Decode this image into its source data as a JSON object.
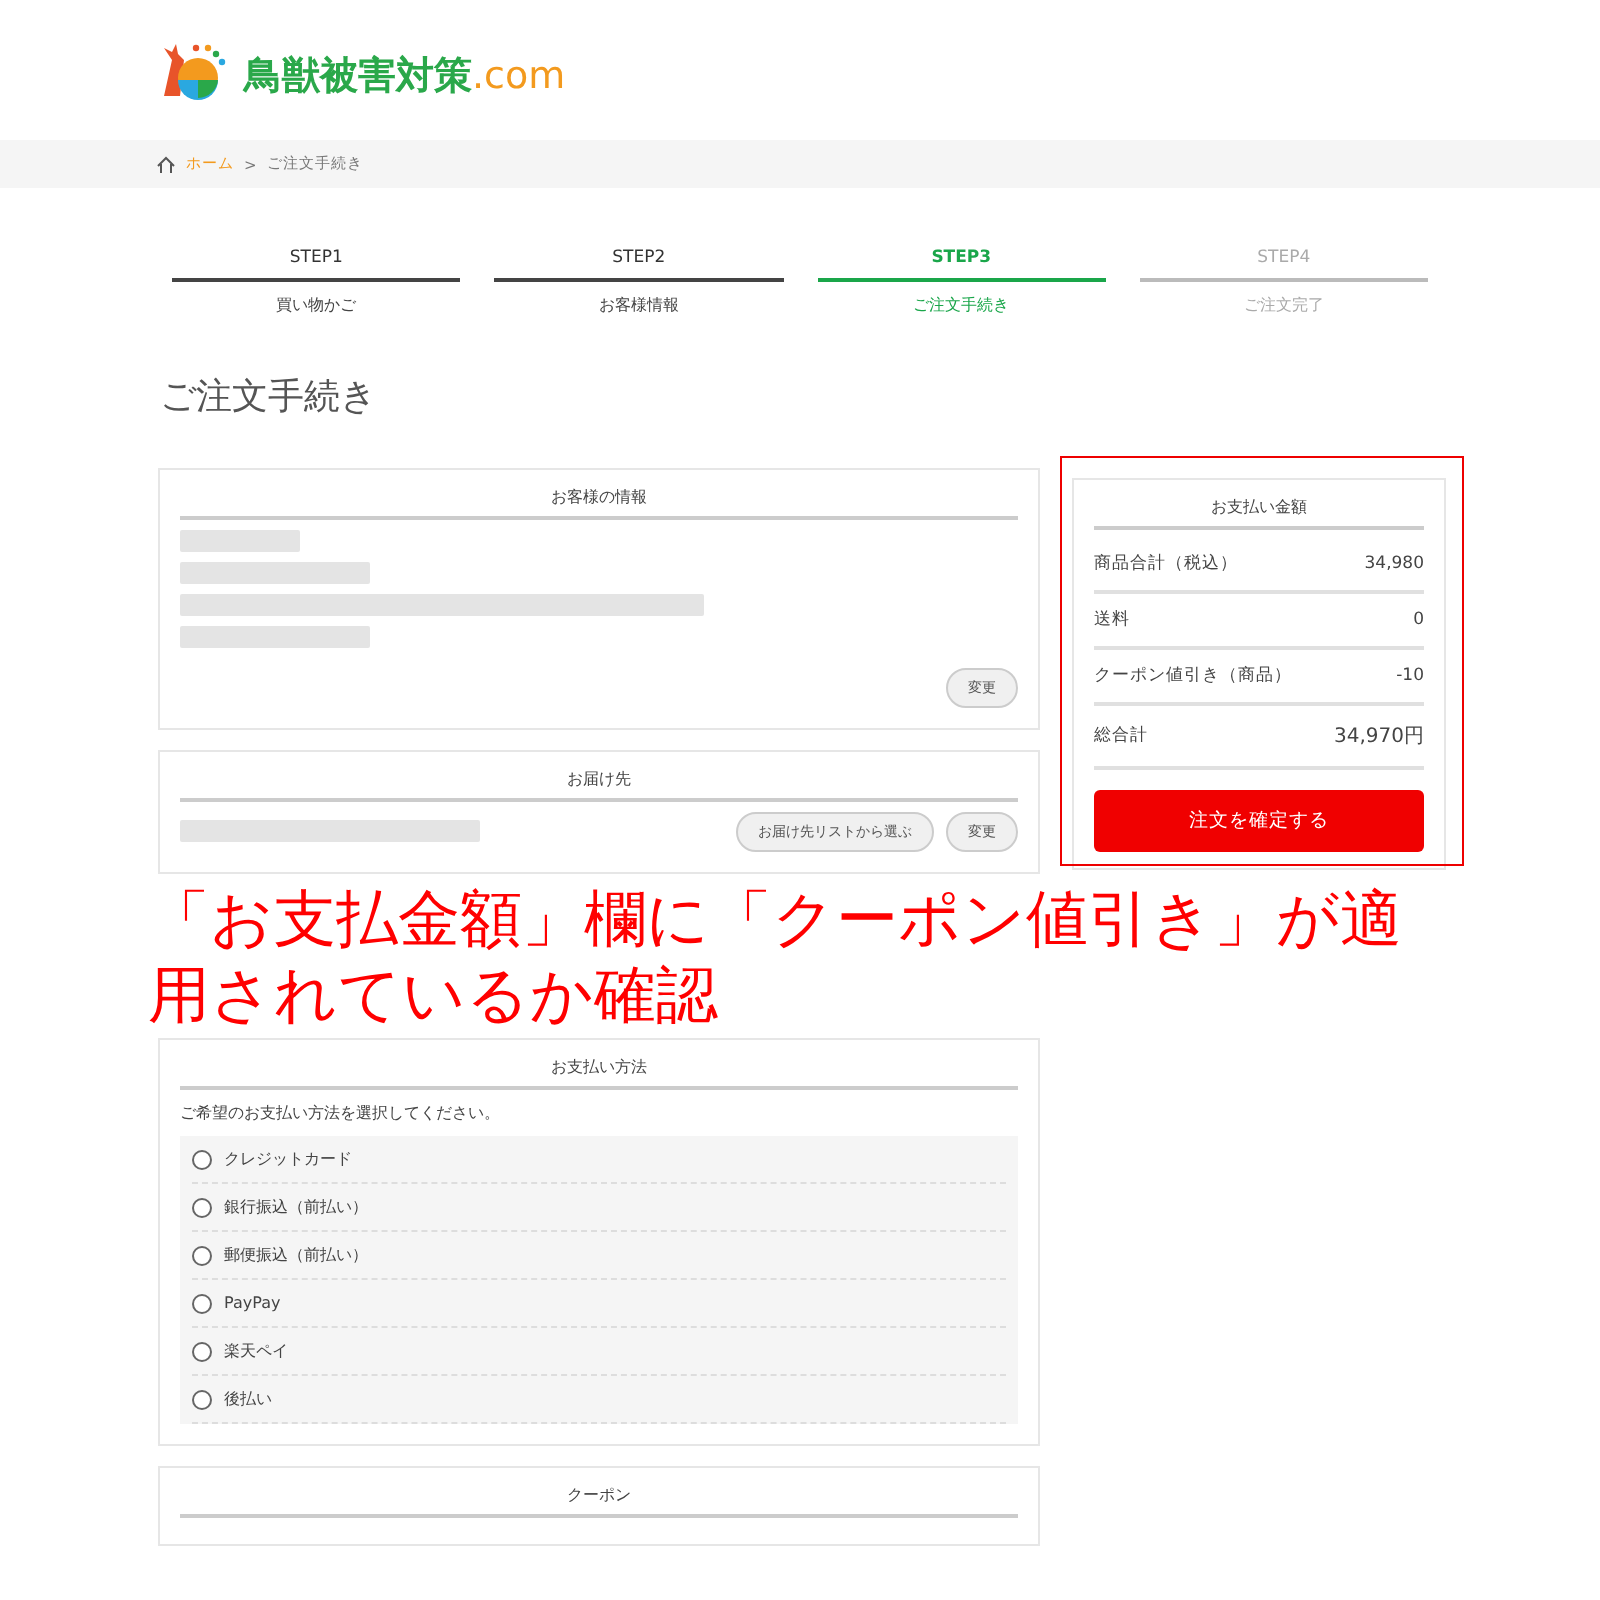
{
  "logo": {
    "text": "鳥獣被害対策",
    "suffix": ".com"
  },
  "breadcrumb": {
    "home": "ホーム",
    "separator": ">",
    "current": "ご注文手続き"
  },
  "steps": [
    {
      "step": "STEP1",
      "label": "買い物かご",
      "selected": false,
      "disabled": false
    },
    {
      "step": "STEP2",
      "label": "お客様情報",
      "selected": false,
      "disabled": false
    },
    {
      "step": "STEP3",
      "label": "ご注文手続き",
      "selected": true,
      "disabled": false
    },
    {
      "step": "STEP4",
      "label": "ご注文完了",
      "selected": false,
      "disabled": true
    }
  ],
  "page_title": "ご注文手続き",
  "customer": {
    "title": "お客様の情報",
    "change_button": "変更"
  },
  "delivery": {
    "title": "お届け先",
    "change_button": "変更",
    "list_button": "お届け先リストから選ぶ"
  },
  "payment": {
    "title": "お支払い方法",
    "instruction": "ご希望のお支払い方法を選択してください。",
    "options": [
      {
        "label": "クレジットカード",
        "selected": false
      },
      {
        "label": "銀行振込（前払い）",
        "selected": false
      },
      {
        "label": "郵便振込（前払い）",
        "selected": false
      },
      {
        "label": "PayPay",
        "selected": false
      },
      {
        "label": "楽天ペイ",
        "selected": false
      },
      {
        "label": "後払い",
        "selected": false
      }
    ]
  },
  "coupon": {
    "title": "クーポン"
  },
  "summary": {
    "title": "お支払い金額",
    "rows": [
      {
        "label": "商品合計（税込）",
        "value": "34,980"
      },
      {
        "label": "送料",
        "value": "0"
      },
      {
        "label": "クーポン値引き（商品）",
        "value": "-10"
      }
    ],
    "total_label": "総合計",
    "total_value": "34,970円",
    "confirm_button": "注文を確定する"
  },
  "annotation": {
    "text": "「お支払金額」欄に「クーポン値引き」が適用されているか確認"
  }
}
